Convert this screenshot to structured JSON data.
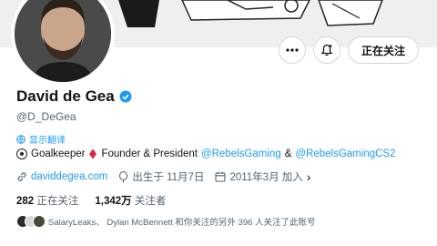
{
  "profile": {
    "name": "David de Gea",
    "handle": "@D_DeGea",
    "translate_label": "显示翻译",
    "verified_color": "#1d9bf0"
  },
  "bio": {
    "part1": "Goalkeeper",
    "part2": "Founder & President",
    "mention1": "@RebelsGaming",
    "amp": "&",
    "mention2": "@RebelsGamingCS2"
  },
  "meta": {
    "website": "daviddegea.com",
    "birthday": "出生于 11月7日",
    "joined": "2011年3月 加入",
    "joined_chevron": "›"
  },
  "stats": {
    "following_count": "282",
    "following_label": "正在关注",
    "followers_count": "1,342万",
    "followers_label": "关注者"
  },
  "followed_by": {
    "text": "SalaryLeaks、 Dylan McBennett 和你关注的另外 396 人关注了此账号"
  },
  "actions": {
    "follow_label": "正在关注"
  },
  "icons": {
    "more": "more-icon",
    "notify": "notification-bell-icon",
    "football": "soccer-ball-icon",
    "diamond": "red-diamond-icon",
    "link": "link-icon",
    "balloon": "balloon-icon",
    "calendar": "calendar-icon"
  },
  "colors": {
    "accent": "#1d9bf0",
    "muted": "#536471",
    "text": "#0f1419"
  }
}
